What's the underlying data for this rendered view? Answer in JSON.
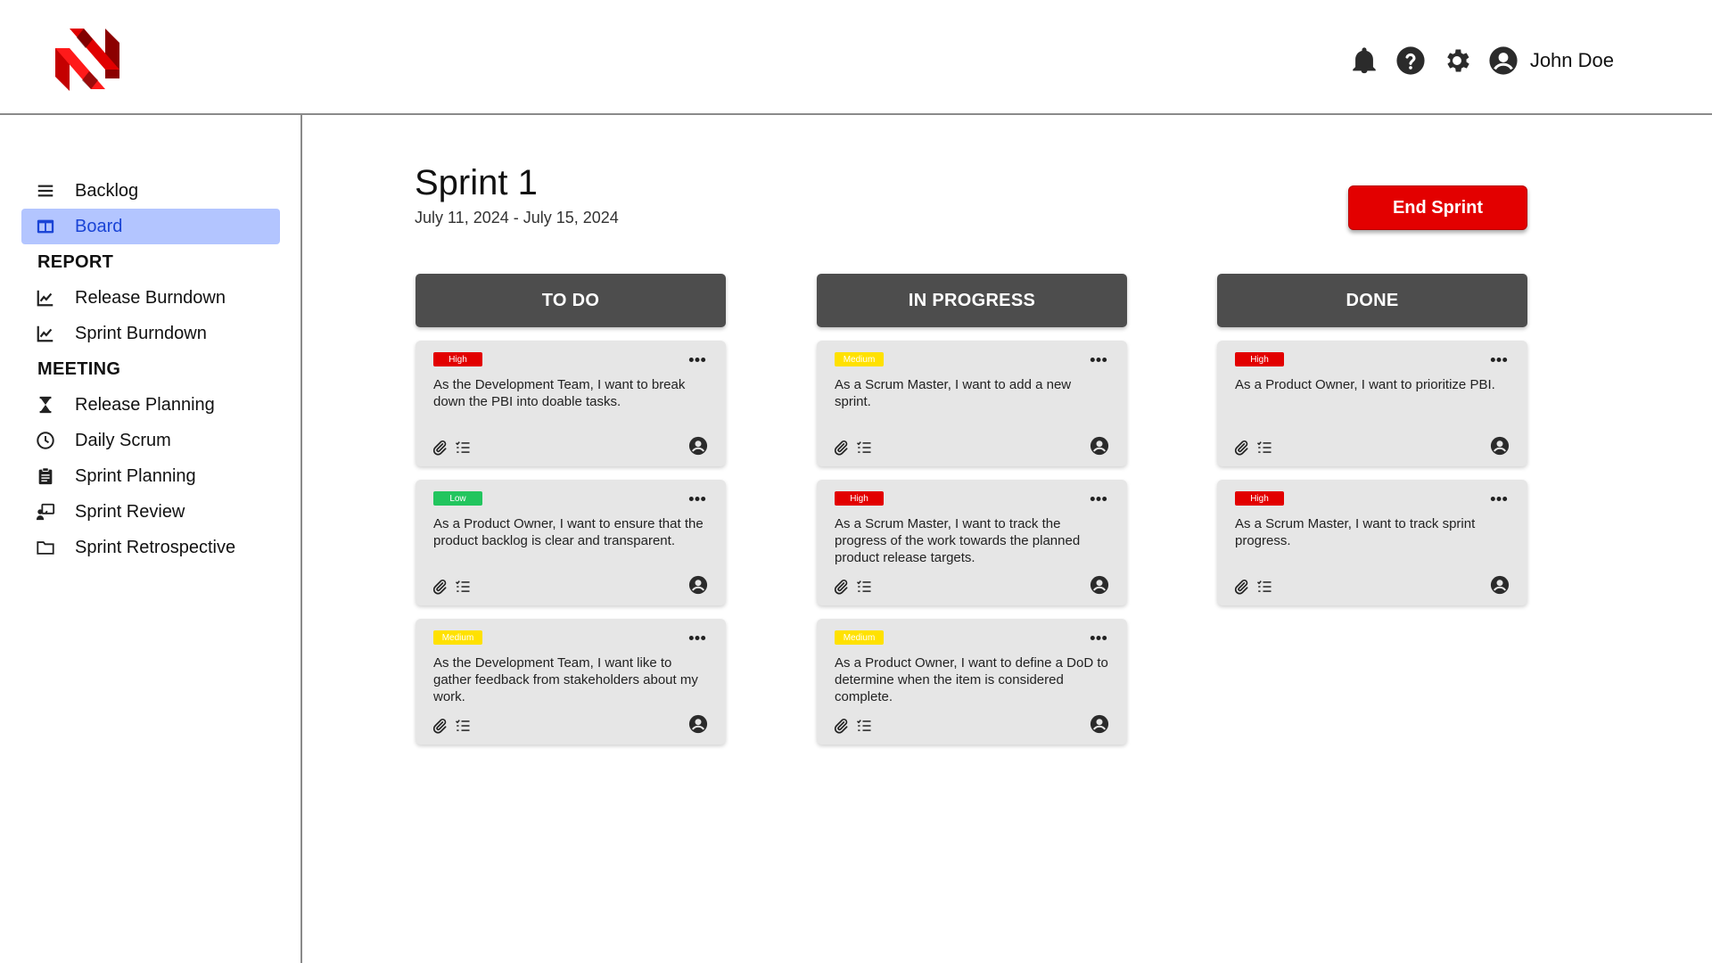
{
  "header": {
    "logo_icon": "scrum-logo-icon",
    "notification_icon": "bell-icon",
    "help_icon": "help-icon",
    "settings_icon": "gear-icon",
    "avatar_icon": "user-circle-icon",
    "user_name": "John Doe"
  },
  "sidebar": {
    "items": [
      {
        "label": "Backlog",
        "icon": "list-icon"
      },
      {
        "label": "Board",
        "icon": "board-icon",
        "active": true
      }
    ],
    "report_heading": "REPORT",
    "report_items": [
      {
        "label": "Release Burndown",
        "icon": "chart-line-icon"
      },
      {
        "label": "Sprint Burndown",
        "icon": "chart-line-icon"
      }
    ],
    "meeting_heading": "MEETING",
    "meeting_items": [
      {
        "label": "Release Planning",
        "icon": "hourglass-icon"
      },
      {
        "label": "Daily Scrum",
        "icon": "clock-icon"
      },
      {
        "label": "Sprint Planning",
        "icon": "clipboard-icon"
      },
      {
        "label": "Sprint Review",
        "icon": "presentation-icon"
      },
      {
        "label": "Sprint Retrospective",
        "icon": "folder-icon"
      }
    ]
  },
  "main": {
    "title": "Sprint 1",
    "dates": "July 11, 2024 - July 15, 2024",
    "end_sprint_label": "End Sprint"
  },
  "columns": [
    {
      "title": "TO DO",
      "cards": [
        {
          "priority": "High",
          "text": "As the Development Team, I want to break down the PBI into doable tasks."
        },
        {
          "priority": "Low",
          "text": "As a Product Owner, I want to ensure that the product backlog is clear and transparent."
        },
        {
          "priority": "Medium",
          "text": "As the Development Team, I want like to gather feedback from stakeholders about my work."
        }
      ]
    },
    {
      "title": "IN PROGRESS",
      "cards": [
        {
          "priority": "Medium",
          "text": "As a Scrum Master, I want to add a new sprint."
        },
        {
          "priority": "High",
          "text": "As a Scrum Master, I want to track the progress of the work towards the planned product release targets."
        },
        {
          "priority": "Medium",
          "text": "As a Product Owner, I want to define a DoD to determine when the item is considered complete."
        }
      ]
    },
    {
      "title": "DONE",
      "cards": [
        {
          "priority": "High",
          "text": "As a Product Owner, I want to prioritize PBI."
        },
        {
          "priority": "High",
          "text": "As a Scrum Master, I want to track sprint progress."
        }
      ]
    }
  ],
  "colors": {
    "high": "#e20000",
    "medium": "#ffe100",
    "low": "#22c55e",
    "accent": "#e30000",
    "active_nav_bg": "#b3c5ff",
    "active_nav_text": "#1a44d6",
    "column_header": "#4d4d4d",
    "card_bg": "#e6e6e6"
  },
  "card_icons": [
    "paperclip-icon",
    "checklist-icon",
    "more-icon",
    "user-circle-icon"
  ]
}
